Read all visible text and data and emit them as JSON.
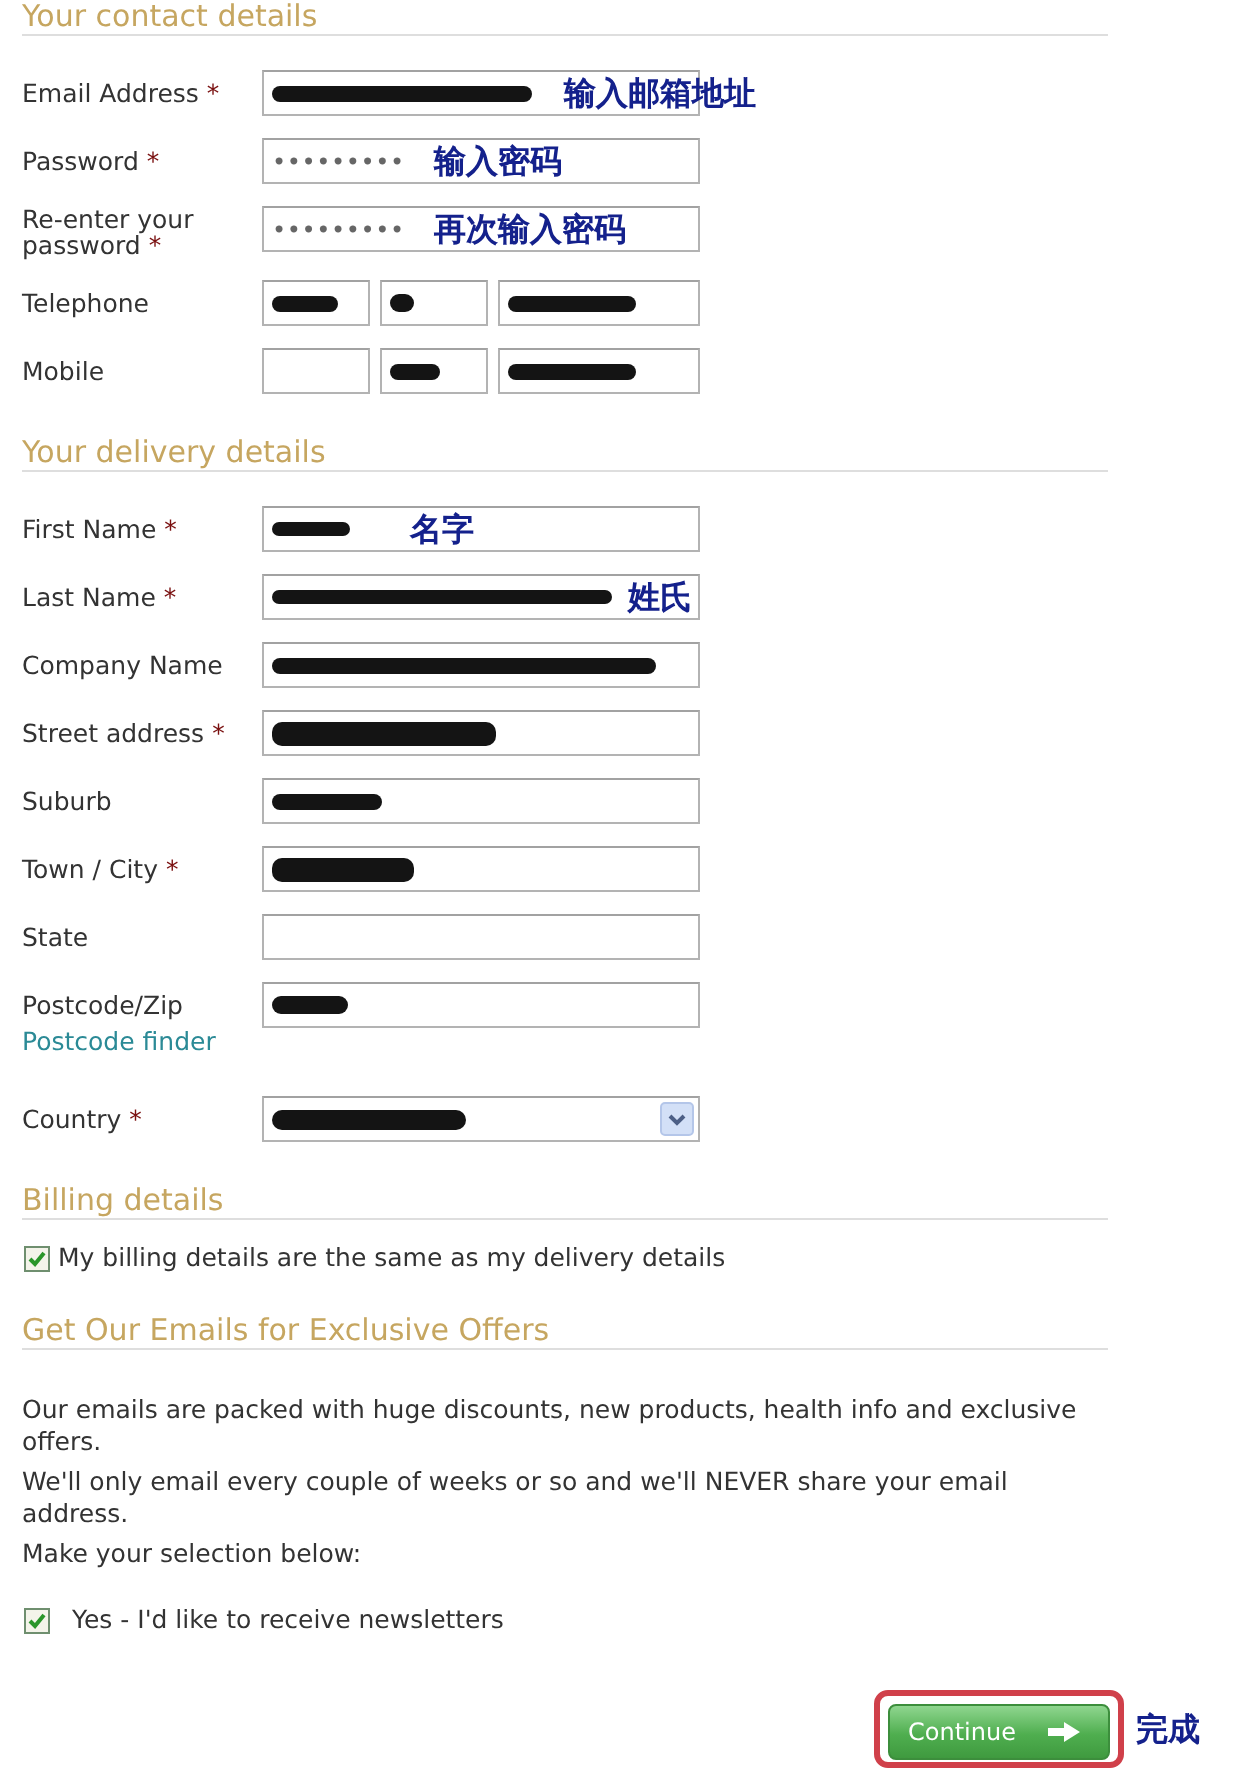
{
  "sections": [
    {
      "kind": "form",
      "title": "Your contact details",
      "rows": [
        {
          "kind": "input",
          "label": "Email Address",
          "required_mark": "*",
          "fields": [
            {
              "redacted": true,
              "annotation": "输入邮箱地址"
            }
          ]
        },
        {
          "kind": "input",
          "label": "Password",
          "required_mark": "*",
          "fields": [
            {
              "value": "•••••••••",
              "redacted": false,
              "annotation": "输入密码"
            }
          ]
        },
        {
          "kind": "input",
          "label": "Re-enter your password",
          "required_mark": "*",
          "fields": [
            {
              "value": "•••••••••",
              "redacted": false,
              "annotation": "再次输入密码"
            }
          ]
        },
        {
          "kind": "input",
          "label": "Telephone",
          "fields": [
            {
              "redacted": true
            },
            {
              "redacted": true
            },
            {
              "redacted": true
            }
          ]
        },
        {
          "kind": "input",
          "label": "Mobile",
          "fields": [
            {
              "redacted": false
            },
            {
              "redacted": true
            },
            {
              "redacted": true
            }
          ]
        }
      ]
    },
    {
      "kind": "form",
      "title": "Your delivery details",
      "rows": [
        {
          "kind": "input",
          "label": "First Name",
          "required_mark": "*",
          "fields": [
            {
              "redacted": true,
              "annotation": "名字"
            }
          ]
        },
        {
          "kind": "input",
          "label": "Last Name",
          "required_mark": "*",
          "fields": [
            {
              "redacted": true,
              "annotation": "姓氏"
            }
          ]
        },
        {
          "kind": "input",
          "label": "Company Name",
          "fields": [
            {
              "redacted": true
            }
          ]
        },
        {
          "kind": "input",
          "label": "Street address",
          "required_mark": "*",
          "fields": [
            {
              "redacted": true
            }
          ]
        },
        {
          "kind": "input",
          "label": "Suburb",
          "fields": [
            {
              "redacted": true
            }
          ]
        },
        {
          "kind": "input",
          "label": "Town / City",
          "required_mark": "*",
          "fields": [
            {
              "redacted": true
            }
          ]
        },
        {
          "kind": "input",
          "label": "State",
          "fields": [
            {
              "redacted": false
            }
          ]
        },
        {
          "kind": "input",
          "label": "Postcode/Zip",
          "link": "Postcode finder",
          "fields": [
            {
              "redacted": true
            }
          ]
        },
        {
          "kind": "select",
          "label": "Country",
          "required_mark": "*",
          "fields": [
            {
              "redacted": true
            }
          ]
        }
      ]
    },
    {
      "kind": "options",
      "title": "Billing details",
      "checkboxes": [
        {
          "label": "My billing details are the same as my delivery details",
          "checked": true
        }
      ]
    },
    {
      "kind": "newsletter",
      "title": "Get Our Emails for Exclusive Offers",
      "paragraphs": [
        "Our emails are packed with huge discounts, new products, health info and exclusive offers.",
        "We'll only email every couple of weeks or so and we'll NEVER share your email address.",
        "Make your selection below:"
      ],
      "checkboxes": [
        {
          "label": "Yes - I'd like to receive newsletters",
          "checked": true
        }
      ]
    }
  ],
  "footer": {
    "continue_button": {
      "label": "Continue",
      "highlighted": true
    },
    "annotation": "完成"
  }
}
